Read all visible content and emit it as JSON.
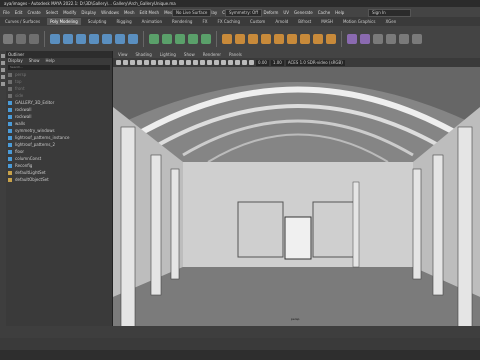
{
  "window": {
    "title": "aya/images - Autodesk MAYA 2022.1: D:\\3D\\Gallery\\... Gallery\\Arch_GalleryUnique.ma"
  },
  "menubar": {
    "items": [
      "File",
      "Edit",
      "Create",
      "Select",
      "Modify",
      "Display",
      "Windows",
      "Mesh",
      "Edit Mesh",
      "Mesh Tools",
      "Mesh Display",
      "Curves",
      "Surfaces",
      "Deform",
      "UV",
      "Generate",
      "Cache",
      "Help"
    ],
    "live_surface": "No Live Surface",
    "symmetry": "Symmetry: Off",
    "sign_in": "Sign In"
  },
  "tabs": {
    "items": [
      "Curves / Surfaces",
      "Poly Modeling",
      "Sculpting",
      "Rigging",
      "Animation",
      "Rendering",
      "FX",
      "FX Caching",
      "Custom",
      "Arnold",
      "Bifrost",
      "MASH",
      "Motion Graphics",
      "XGen"
    ],
    "active_index": 1
  },
  "outliner": {
    "title": "Outliner",
    "menu": [
      "Display",
      "Show",
      "Help"
    ],
    "search_placeholder": "Search...",
    "items": [
      {
        "label": "persp",
        "dim": true,
        "icon_color": "#6f6f6f"
      },
      {
        "label": "top",
        "dim": true,
        "icon_color": "#6f6f6f"
      },
      {
        "label": "front",
        "dim": true,
        "icon_color": "#6f6f6f"
      },
      {
        "label": "side",
        "dim": true,
        "icon_color": "#6f6f6f"
      },
      {
        "label": "GALLERY_3D_Editor",
        "dim": false,
        "icon_color": "#4a9bd8"
      },
      {
        "label": "rockwall",
        "dim": false,
        "icon_color": "#4a9bd8"
      },
      {
        "label": "rockwall",
        "dim": false,
        "icon_color": "#4a9bd8"
      },
      {
        "label": "walls",
        "dim": false,
        "icon_color": "#4a9bd8"
      },
      {
        "label": "symmetry_windows",
        "dim": false,
        "icon_color": "#4a9bd8"
      },
      {
        "label": "lightroof_patterns_instance",
        "dim": false,
        "icon_color": "#4a9bd8"
      },
      {
        "label": "lightroof_patterns_2",
        "dim": false,
        "icon_color": "#4a9bd8"
      },
      {
        "label": "floor",
        "dim": false,
        "icon_color": "#4a9bd8"
      },
      {
        "label": "columnConst",
        "dim": false,
        "icon_color": "#4a9bd8"
      },
      {
        "label": "Reconfig",
        "dim": false,
        "icon_color": "#4a9bd8"
      },
      {
        "label": "defaultLightSet",
        "dim": false,
        "icon_color": "#c8a24a"
      },
      {
        "label": "defaultObjectSet",
        "dim": false,
        "icon_color": "#c8a24a"
      }
    ]
  },
  "viewport": {
    "menu": [
      "View",
      "Shading",
      "Lighting",
      "Show",
      "Renderer",
      "Panels"
    ],
    "color_space": "ACES 1.0 SDR-video (sRGB)",
    "gamma": "1.00",
    "exposure": "0.00",
    "camera_label": "persp"
  },
  "colors": {
    "accent": "#5a8fc0",
    "tab_active": "#5a5a5a"
  }
}
